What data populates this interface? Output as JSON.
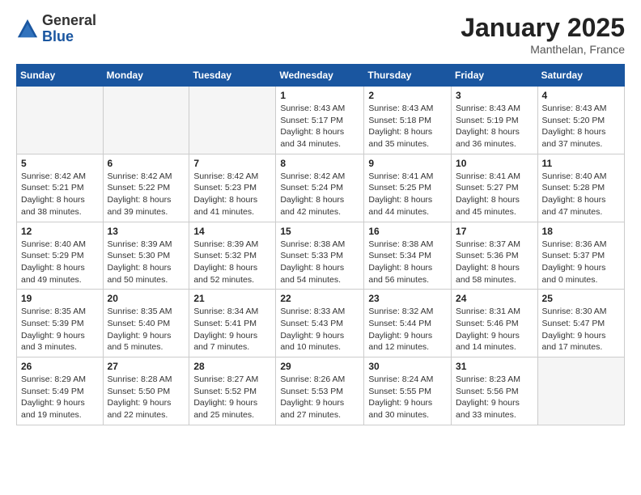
{
  "logo": {
    "general": "General",
    "blue": "Blue"
  },
  "title": "January 2025",
  "subtitle": "Manthelan, France",
  "days_of_week": [
    "Sunday",
    "Monday",
    "Tuesday",
    "Wednesday",
    "Thursday",
    "Friday",
    "Saturday"
  ],
  "weeks": [
    [
      {
        "day": "",
        "info": ""
      },
      {
        "day": "",
        "info": ""
      },
      {
        "day": "",
        "info": ""
      },
      {
        "day": "1",
        "info": "Sunrise: 8:43 AM\nSunset: 5:17 PM\nDaylight: 8 hours and 34 minutes."
      },
      {
        "day": "2",
        "info": "Sunrise: 8:43 AM\nSunset: 5:18 PM\nDaylight: 8 hours and 35 minutes."
      },
      {
        "day": "3",
        "info": "Sunrise: 8:43 AM\nSunset: 5:19 PM\nDaylight: 8 hours and 36 minutes."
      },
      {
        "day": "4",
        "info": "Sunrise: 8:43 AM\nSunset: 5:20 PM\nDaylight: 8 hours and 37 minutes."
      }
    ],
    [
      {
        "day": "5",
        "info": "Sunrise: 8:42 AM\nSunset: 5:21 PM\nDaylight: 8 hours and 38 minutes."
      },
      {
        "day": "6",
        "info": "Sunrise: 8:42 AM\nSunset: 5:22 PM\nDaylight: 8 hours and 39 minutes."
      },
      {
        "day": "7",
        "info": "Sunrise: 8:42 AM\nSunset: 5:23 PM\nDaylight: 8 hours and 41 minutes."
      },
      {
        "day": "8",
        "info": "Sunrise: 8:42 AM\nSunset: 5:24 PM\nDaylight: 8 hours and 42 minutes."
      },
      {
        "day": "9",
        "info": "Sunrise: 8:41 AM\nSunset: 5:25 PM\nDaylight: 8 hours and 44 minutes."
      },
      {
        "day": "10",
        "info": "Sunrise: 8:41 AM\nSunset: 5:27 PM\nDaylight: 8 hours and 45 minutes."
      },
      {
        "day": "11",
        "info": "Sunrise: 8:40 AM\nSunset: 5:28 PM\nDaylight: 8 hours and 47 minutes."
      }
    ],
    [
      {
        "day": "12",
        "info": "Sunrise: 8:40 AM\nSunset: 5:29 PM\nDaylight: 8 hours and 49 minutes."
      },
      {
        "day": "13",
        "info": "Sunrise: 8:39 AM\nSunset: 5:30 PM\nDaylight: 8 hours and 50 minutes."
      },
      {
        "day": "14",
        "info": "Sunrise: 8:39 AM\nSunset: 5:32 PM\nDaylight: 8 hours and 52 minutes."
      },
      {
        "day": "15",
        "info": "Sunrise: 8:38 AM\nSunset: 5:33 PM\nDaylight: 8 hours and 54 minutes."
      },
      {
        "day": "16",
        "info": "Sunrise: 8:38 AM\nSunset: 5:34 PM\nDaylight: 8 hours and 56 minutes."
      },
      {
        "day": "17",
        "info": "Sunrise: 8:37 AM\nSunset: 5:36 PM\nDaylight: 8 hours and 58 minutes."
      },
      {
        "day": "18",
        "info": "Sunrise: 8:36 AM\nSunset: 5:37 PM\nDaylight: 9 hours and 0 minutes."
      }
    ],
    [
      {
        "day": "19",
        "info": "Sunrise: 8:35 AM\nSunset: 5:39 PM\nDaylight: 9 hours and 3 minutes."
      },
      {
        "day": "20",
        "info": "Sunrise: 8:35 AM\nSunset: 5:40 PM\nDaylight: 9 hours and 5 minutes."
      },
      {
        "day": "21",
        "info": "Sunrise: 8:34 AM\nSunset: 5:41 PM\nDaylight: 9 hours and 7 minutes."
      },
      {
        "day": "22",
        "info": "Sunrise: 8:33 AM\nSunset: 5:43 PM\nDaylight: 9 hours and 10 minutes."
      },
      {
        "day": "23",
        "info": "Sunrise: 8:32 AM\nSunset: 5:44 PM\nDaylight: 9 hours and 12 minutes."
      },
      {
        "day": "24",
        "info": "Sunrise: 8:31 AM\nSunset: 5:46 PM\nDaylight: 9 hours and 14 minutes."
      },
      {
        "day": "25",
        "info": "Sunrise: 8:30 AM\nSunset: 5:47 PM\nDaylight: 9 hours and 17 minutes."
      }
    ],
    [
      {
        "day": "26",
        "info": "Sunrise: 8:29 AM\nSunset: 5:49 PM\nDaylight: 9 hours and 19 minutes."
      },
      {
        "day": "27",
        "info": "Sunrise: 8:28 AM\nSunset: 5:50 PM\nDaylight: 9 hours and 22 minutes."
      },
      {
        "day": "28",
        "info": "Sunrise: 8:27 AM\nSunset: 5:52 PM\nDaylight: 9 hours and 25 minutes."
      },
      {
        "day": "29",
        "info": "Sunrise: 8:26 AM\nSunset: 5:53 PM\nDaylight: 9 hours and 27 minutes."
      },
      {
        "day": "30",
        "info": "Sunrise: 8:24 AM\nSunset: 5:55 PM\nDaylight: 9 hours and 30 minutes."
      },
      {
        "day": "31",
        "info": "Sunrise: 8:23 AM\nSunset: 5:56 PM\nDaylight: 9 hours and 33 minutes."
      },
      {
        "day": "",
        "info": ""
      }
    ]
  ]
}
